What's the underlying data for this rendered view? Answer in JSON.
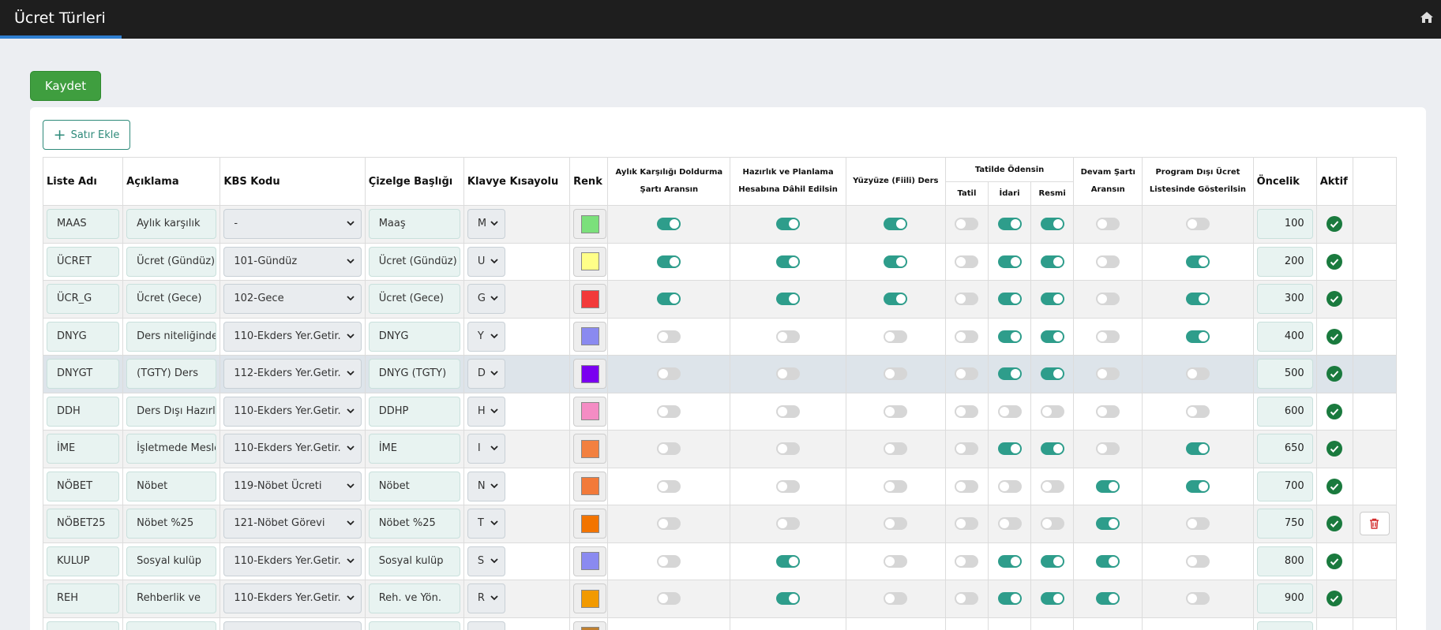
{
  "app": {
    "title": "Ücret Türleri",
    "home_icon": "home-icon",
    "progress": 0.085
  },
  "toolbar": {
    "save_label": "Kaydet",
    "add_row_label": "Satır Ekle"
  },
  "columns": {
    "liste_adi": "Liste Adı",
    "aciklama": "Açıklama",
    "kbs_kodu": "KBS Kodu",
    "cizelge": "Çizelge Başlığı",
    "klavye": "Klavye Kısayolu",
    "renk": "Renk",
    "aylik": "Aylık Karşılığı Doldurma Şartı Aransın",
    "hazirlik": "Hazırlık ve Planlama Hesabına Dâhil Edilsin",
    "yuzyuze": "Yüzyüze (Fiili) Ders",
    "tatilde": "Tatilde Ödensin",
    "tatil": "Tatil",
    "idari": "İdari",
    "resmi": "Resmi",
    "devam": "Devam Şartı Aransın",
    "program": "Program Dışı Ücret Listesinde Gösterilsin",
    "oncelik": "Öncelik",
    "aktif": "Aktif"
  },
  "rows": [
    {
      "liste": "MAAS",
      "aciklama": "Aylık karşılık",
      "kbs": "-",
      "cizelge": "Maaş",
      "klavye": "M",
      "renk": "#7be07b",
      "aylik": true,
      "hazirlik": true,
      "yuzyuze": true,
      "tatil": false,
      "idari": true,
      "resmi": true,
      "devam": false,
      "program": false,
      "oncelik": "100",
      "aktif": true,
      "delete": false
    },
    {
      "liste": "ÜCRET",
      "aciklama": "Ücret (Gündüz)",
      "kbs": "101-Gündüz",
      "cizelge": "Ücret (Gündüz)",
      "klavye": "U",
      "renk": "#ffff88",
      "aylik": true,
      "hazirlik": true,
      "yuzyuze": true,
      "tatil": false,
      "idari": true,
      "resmi": true,
      "devam": false,
      "program": true,
      "oncelik": "200",
      "aktif": true,
      "delete": false
    },
    {
      "liste": "ÜCR_G",
      "aciklama": "Ücret (Gece)",
      "kbs": "102-Gece",
      "cizelge": "Ücret (Gece)",
      "klavye": "G",
      "renk": "#f23a3a",
      "aylik": true,
      "hazirlik": true,
      "yuzyuze": true,
      "tatil": false,
      "idari": true,
      "resmi": true,
      "devam": false,
      "program": true,
      "oncelik": "300",
      "aktif": true,
      "delete": false
    },
    {
      "liste": "DNYG",
      "aciklama": "Ders niteliğinde",
      "kbs": "110-Ekders Yer.Getir.",
      "cizelge": "DNYG",
      "klavye": "Y",
      "renk": "#8a8af0",
      "aylik": false,
      "hazirlik": false,
      "yuzyuze": false,
      "tatil": false,
      "idari": true,
      "resmi": true,
      "devam": false,
      "program": true,
      "oncelik": "400",
      "aktif": true,
      "delete": false
    },
    {
      "liste": "DNYGT",
      "aciklama": "(TGTY) Ders",
      "kbs": "112-Ekders Yer.Getir.",
      "cizelge": "DNYG (TGTY)",
      "klavye": "D",
      "renk": "#7a00f0",
      "aylik": false,
      "hazirlik": false,
      "yuzyuze": false,
      "tatil": false,
      "idari": true,
      "resmi": true,
      "devam": false,
      "program": false,
      "oncelik": "500",
      "aktif": true,
      "delete": false
    },
    {
      "liste": "DDH",
      "aciklama": "Ders Dışı Hazırlık",
      "kbs": "110-Ekders Yer.Getir.",
      "cizelge": "DDHP",
      "klavye": "H",
      "renk": "#f48cc4",
      "aylik": false,
      "hazirlik": false,
      "yuzyuze": false,
      "tatil": false,
      "idari": false,
      "resmi": false,
      "devam": false,
      "program": false,
      "oncelik": "600",
      "aktif": true,
      "delete": false
    },
    {
      "liste": "İME",
      "aciklama": "İşletmede Mesleki",
      "kbs": "110-Ekders Yer.Getir.",
      "cizelge": "İME",
      "klavye": "I",
      "renk": "#f28040",
      "aylik": false,
      "hazirlik": false,
      "yuzyuze": false,
      "tatil": false,
      "idari": true,
      "resmi": true,
      "devam": false,
      "program": true,
      "oncelik": "650",
      "aktif": true,
      "delete": false
    },
    {
      "liste": "NÖBET",
      "aciklama": "Nöbet",
      "kbs": "119-Nöbet Ücreti",
      "cizelge": "Nöbet",
      "klavye": "N",
      "renk": "#f27a3a",
      "aylik": false,
      "hazirlik": false,
      "yuzyuze": false,
      "tatil": false,
      "idari": false,
      "resmi": false,
      "devam": true,
      "program": true,
      "oncelik": "700",
      "aktif": true,
      "delete": false
    },
    {
      "liste": "NÖBET25",
      "aciklama": "Nöbet %25",
      "kbs": "121-Nöbet Görevi",
      "cizelge": "Nöbet %25",
      "klavye": "T",
      "renk": "#f27400",
      "aylik": false,
      "hazirlik": false,
      "yuzyuze": false,
      "tatil": false,
      "idari": false,
      "resmi": false,
      "devam": true,
      "program": false,
      "oncelik": "750",
      "aktif": true,
      "delete": true
    },
    {
      "liste": "KULUP",
      "aciklama": "Sosyal kulüp",
      "kbs": "110-Ekders Yer.Getir.",
      "cizelge": "Sosyal kulüp",
      "klavye": "S",
      "renk": "#8a8af0",
      "aylik": false,
      "hazirlik": true,
      "yuzyuze": false,
      "tatil": false,
      "idari": true,
      "resmi": true,
      "devam": true,
      "program": false,
      "oncelik": "800",
      "aktif": true,
      "delete": false
    },
    {
      "liste": "REH",
      "aciklama": "Rehberlik ve",
      "kbs": "110-Ekders Yer.Getir.",
      "cizelge": "Reh. ve Yön.",
      "klavye": "R",
      "renk": "#f29a00",
      "aylik": false,
      "hazirlik": true,
      "yuzyuze": false,
      "tatil": false,
      "idari": true,
      "resmi": true,
      "devam": true,
      "program": false,
      "oncelik": "900",
      "aktif": true,
      "delete": false
    },
    {
      "liste": "",
      "aciklama": "",
      "kbs": "",
      "cizelge": "",
      "klavye": "",
      "renk": "#c08030",
      "aylik": false,
      "hazirlik": false,
      "yuzyuze": false,
      "tatil": false,
      "idari": false,
      "resmi": false,
      "devam": false,
      "program": false,
      "oncelik": "",
      "aktif": false,
      "delete": false
    }
  ],
  "colors": {
    "toggle_on": "#2e9d8b",
    "toggle_off": "#d6d6d6",
    "save": "#3f9e3f",
    "check": "#1a7a3e",
    "delete": "#d32f2f"
  }
}
